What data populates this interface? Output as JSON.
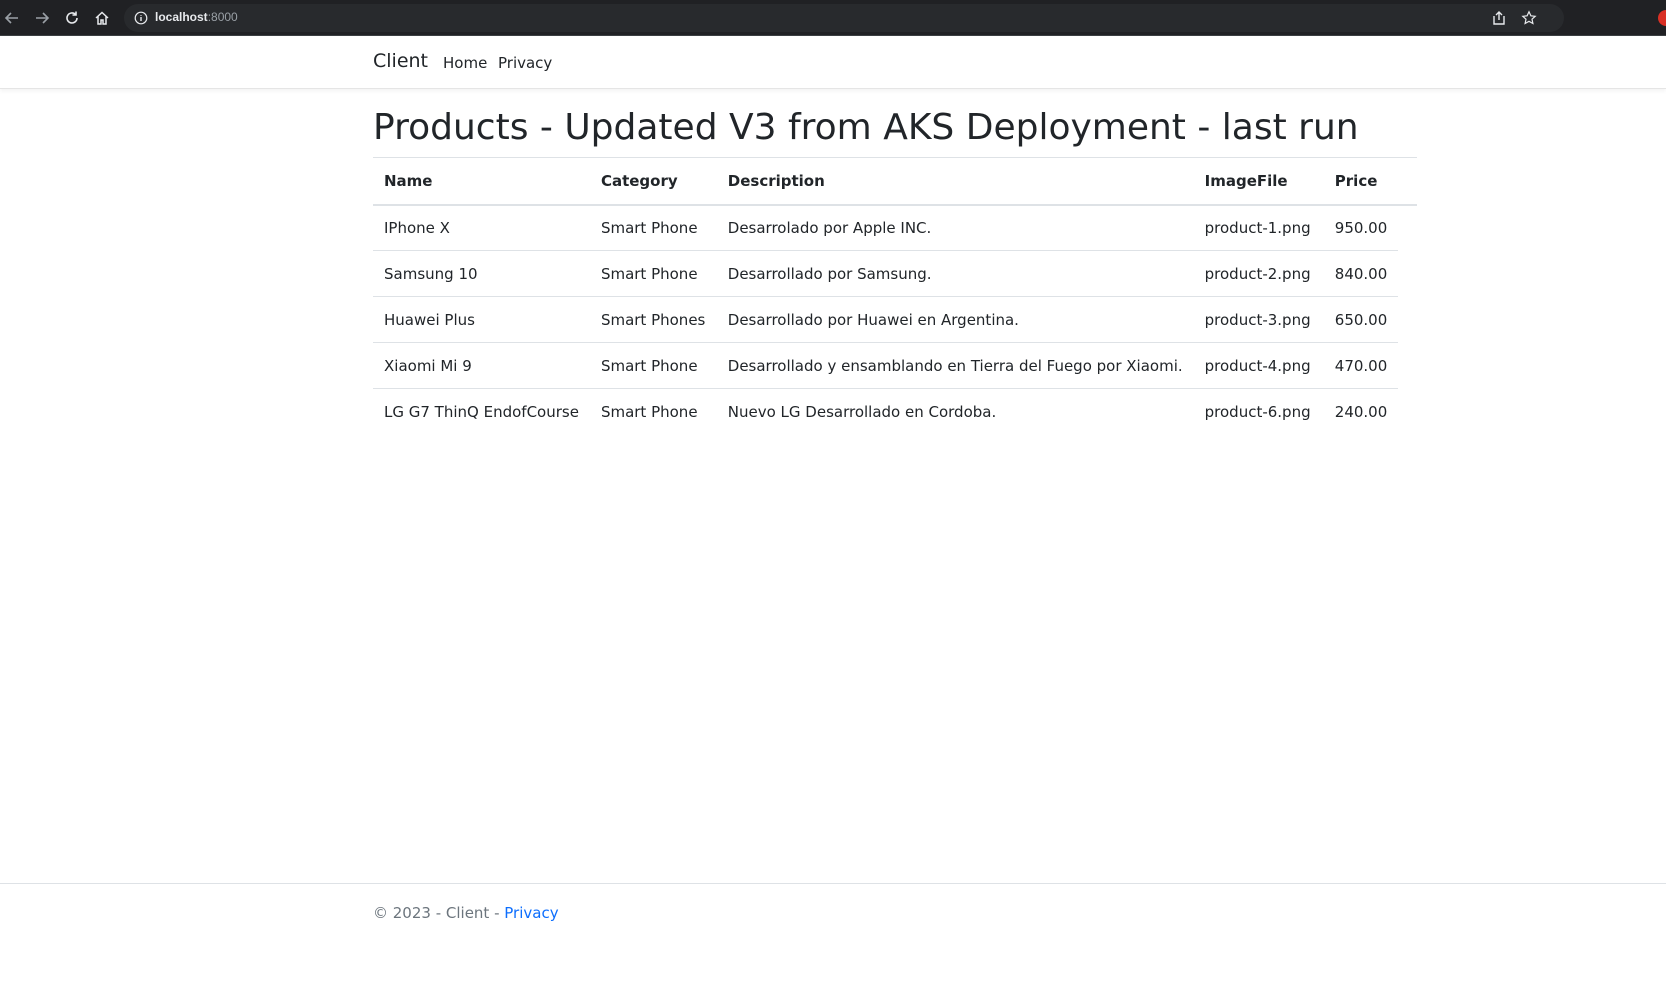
{
  "browser": {
    "url_host": "localhost",
    "url_port": ":8000"
  },
  "navbar": {
    "brand": "Client",
    "links": [
      {
        "label": "Home"
      },
      {
        "label": "Privacy"
      }
    ]
  },
  "main": {
    "title": "Products - Updated V3 from AKS Deployment - last run",
    "table": {
      "headers": [
        "Name",
        "Category",
        "Description",
        "ImageFile",
        "Price"
      ],
      "rows": [
        [
          "IPhone X",
          "Smart Phone",
          "Desarrolado por Apple INC.",
          "product-1.png",
          "950.00"
        ],
        [
          "Samsung 10",
          "Smart Phone",
          "Desarrollado por Samsung.",
          "product-2.png",
          "840.00"
        ],
        [
          "Huawei Plus",
          "Smart Phones",
          "Desarrollado por Huawei en Argentina.",
          "product-3.png",
          "650.00"
        ],
        [
          "Xiaomi Mi 9",
          "Smart Phone",
          "Desarrollado y ensamblando en Tierra del Fuego por Xiaomi.",
          "product-4.png",
          "470.00"
        ],
        [
          "LG G7 ThinQ EndofCourse",
          "Smart Phone",
          "Nuevo LG Desarrollado en Cordoba.",
          "product-6.png",
          "240.00"
        ]
      ]
    }
  },
  "footer": {
    "text": "© 2023 - Client - ",
    "link": "Privacy"
  },
  "colors": {
    "chrome_bg": "#202124",
    "link": "#0d6efd",
    "text": "#212529",
    "muted": "#6c757d"
  }
}
